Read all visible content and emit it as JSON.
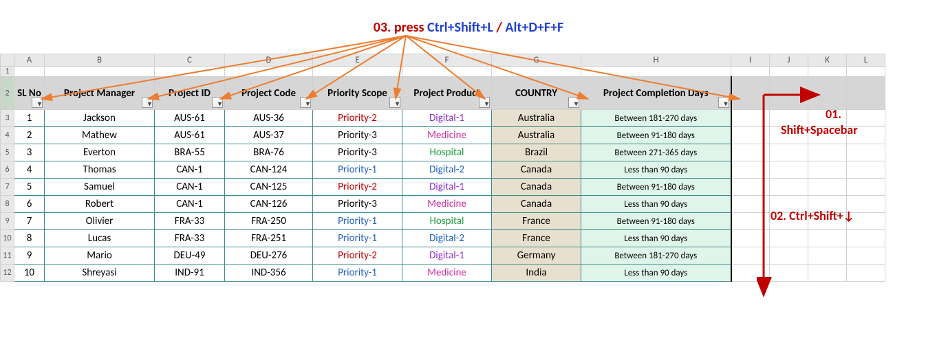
{
  "annotations": {
    "top_prefix": "03. press ",
    "top_shortcut1": "Ctrl+Shift+L",
    "top_sep": " / ",
    "top_shortcut2": "Alt+D+F+F",
    "r1_num": "01.",
    "r1_txt": "Shift+Spacebar",
    "r2_txt": "02.  Ctrl+Shift+↓"
  },
  "col_letters": [
    "A",
    "B",
    "C",
    "D",
    "E",
    "F",
    "G",
    "H",
    "I",
    "J",
    "K",
    "L"
  ],
  "row_nums": [
    "1",
    "2",
    "3",
    "4",
    "5",
    "6",
    "7",
    "8",
    "9",
    "10",
    "11",
    "12"
  ],
  "headers": {
    "A": "SL No",
    "B": "Project Manager",
    "C": "Project ID",
    "D": "Project Code",
    "E": "Priority Scope",
    "F": "Project Product",
    "G": "COUNTRY",
    "H": "Project Completion Days"
  },
  "rows": [
    {
      "sl": "1",
      "mgr": "Jackson",
      "pid": "AUS-61",
      "pcode": "AUS-36",
      "prio": "Priority-2",
      "prioCls": "c-red",
      "prod": "Digital-1",
      "prodCls": "c-purple",
      "cty": "Australia",
      "days": "Between 181-270 days"
    },
    {
      "sl": "2",
      "mgr": "Mathew",
      "pid": "AUS-61",
      "pcode": "AUS-37",
      "prio": "Priority-3",
      "prioCls": "c-black",
      "prod": "Medicine",
      "prodCls": "c-mag",
      "cty": "Australia",
      "days": "Between 91-180 days"
    },
    {
      "sl": "3",
      "mgr": "Everton",
      "pid": "BRA-55",
      "pcode": "BRA-76",
      "prio": "Priority-3",
      "prioCls": "c-black",
      "prod": "Hospital",
      "prodCls": "c-green",
      "cty": "Brazil",
      "days": "Between 271-365 days"
    },
    {
      "sl": "4",
      "mgr": "Thomas",
      "pid": "CAN-1",
      "pcode": "CAN-124",
      "prio": "Priority-1",
      "prioCls": "c-blue",
      "prod": "Digital-2",
      "prodCls": "c-blue",
      "cty": "Canada",
      "days": "Less than 90 days"
    },
    {
      "sl": "5",
      "mgr": "Samuel",
      "pid": "CAN-1",
      "pcode": "CAN-125",
      "prio": "Priority-2",
      "prioCls": "c-red",
      "prod": "Digital-1",
      "prodCls": "c-purple",
      "cty": "Canada",
      "days": "Between 91-180 days"
    },
    {
      "sl": "6",
      "mgr": "Robert",
      "pid": "CAN-1",
      "pcode": "CAN-126",
      "prio": "Priority-3",
      "prioCls": "c-black",
      "prod": "Medicine",
      "prodCls": "c-mag",
      "cty": "Canada",
      "days": "Less than 90 days"
    },
    {
      "sl": "7",
      "mgr": "Olivier",
      "pid": "FRA-33",
      "pcode": "FRA-250",
      "prio": "Priority-1",
      "prioCls": "c-blue",
      "prod": "Hospital",
      "prodCls": "c-green",
      "cty": "France",
      "days": "Between 91-180 days"
    },
    {
      "sl": "8",
      "mgr": "Lucas",
      "pid": "FRA-33",
      "pcode": "FRA-251",
      "prio": "Priority-1",
      "prioCls": "c-blue",
      "prod": "Digital-2",
      "prodCls": "c-blue",
      "cty": "France",
      "days": "Less than 90 days"
    },
    {
      "sl": "9",
      "mgr": "Mario",
      "pid": "DEU-49",
      "pcode": "DEU-276",
      "prio": "Priority-2",
      "prioCls": "c-red",
      "prod": "Digital-1",
      "prodCls": "c-purple",
      "cty": "Germany",
      "days": "Between 181-270 days"
    },
    {
      "sl": "10",
      "mgr": "Shreyasi",
      "pid": "IND-91",
      "pcode": "IND-356",
      "prio": "Priority-1",
      "prioCls": "c-blue",
      "prod": "Medicine",
      "prodCls": "c-mag",
      "cty": "India",
      "days": "Less than 90 days"
    }
  ]
}
